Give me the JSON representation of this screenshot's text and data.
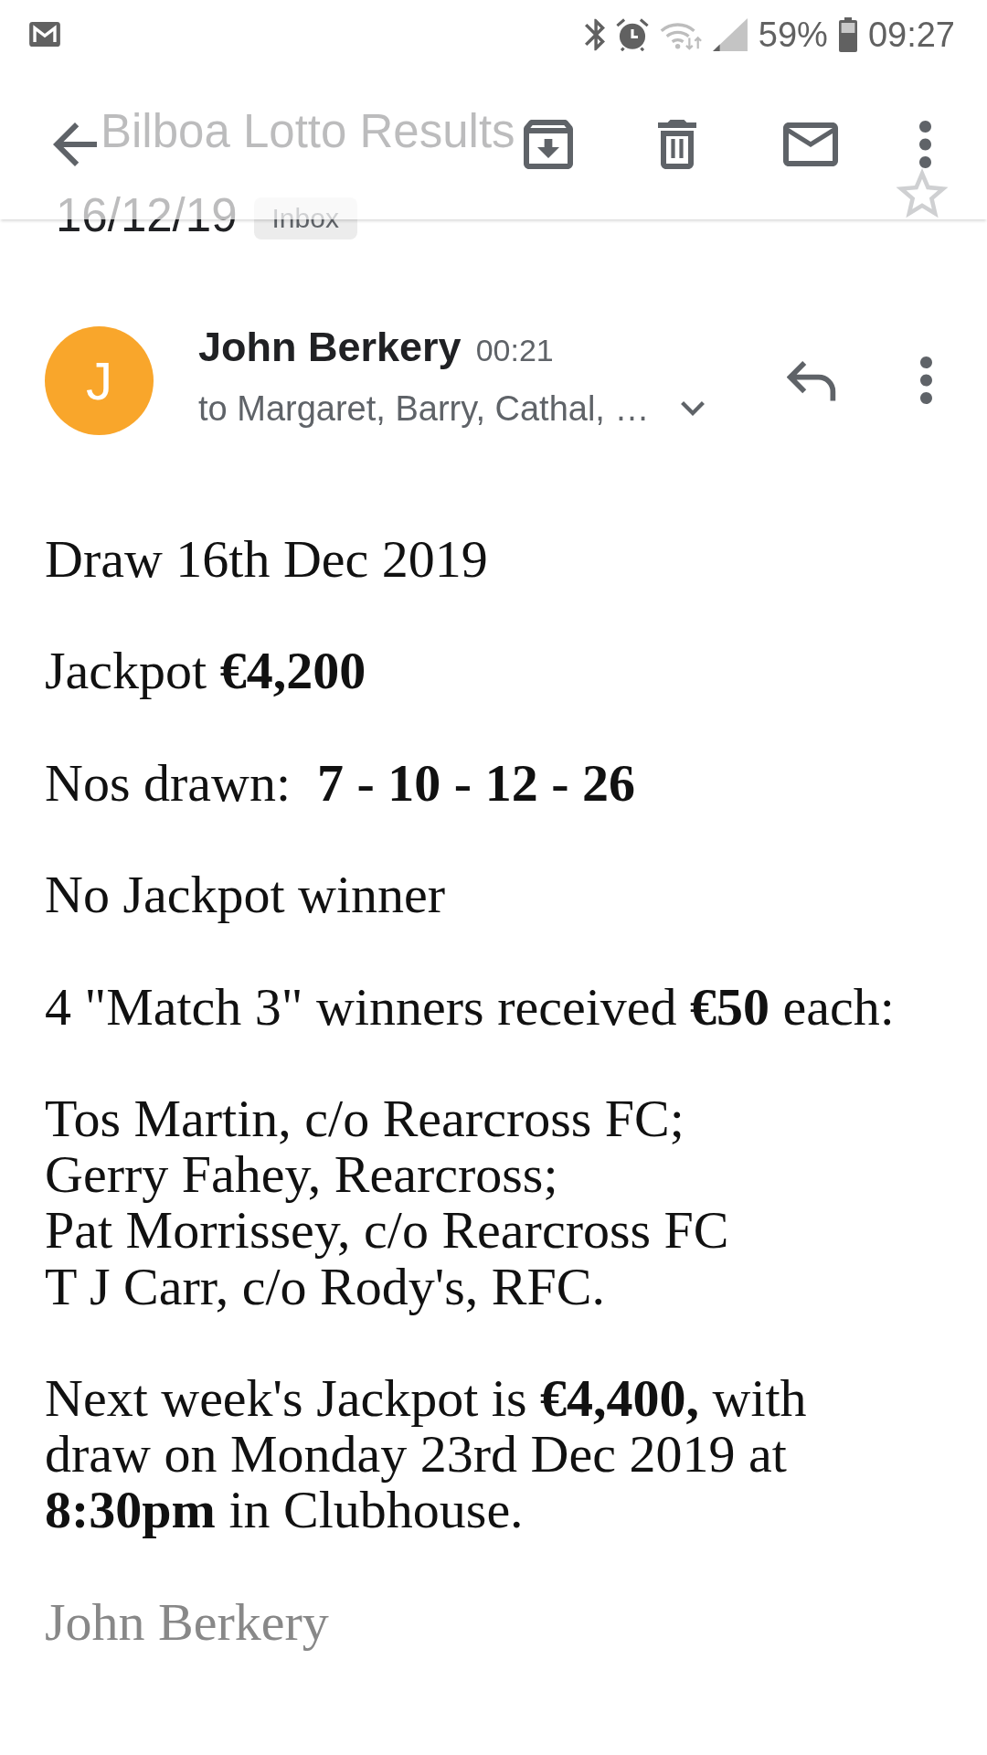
{
  "status_bar": {
    "battery": "59%",
    "time": "09:27"
  },
  "subject": {
    "title_lines": [
      "Bilboa Lotto Results",
      "16/12/19"
    ],
    "label": "Inbox",
    "starred": false
  },
  "message": {
    "avatar_letter": "J",
    "sender": "John Berkery",
    "time": "00:21",
    "recipients": "to Margaret, Barry, Cathal, …"
  },
  "body": [
    {
      "kind": "paragraph",
      "text": "Draw 16th Dec 2019"
    },
    {
      "kind": "paragraph",
      "text": "Jackpot **€4,200**"
    },
    {
      "kind": "paragraph",
      "text": "Nos drawn:  **7 - 10 - 12 - 26**"
    },
    {
      "kind": "paragraph",
      "text": "No Jackpot winner"
    },
    {
      "kind": "paragraph",
      "text": "4 \"Match 3\" winners received **€50** each:"
    },
    {
      "kind": "lines",
      "lines": [
        "Tos Martin, c/o Rearcross FC;",
        "Gerry Fahey, Rearcross;",
        "Pat Morrissey, c/o Rearcross FC",
        "T J Carr, c/o Rody's, RFC."
      ]
    },
    {
      "kind": "paragraph",
      "text": "Next week's Jackpot is **€4,400,** with draw on Monday 23rd Dec 2019 at **8:30pm** in Clubhouse."
    },
    {
      "kind": "signature",
      "text": "John Berkery"
    }
  ]
}
